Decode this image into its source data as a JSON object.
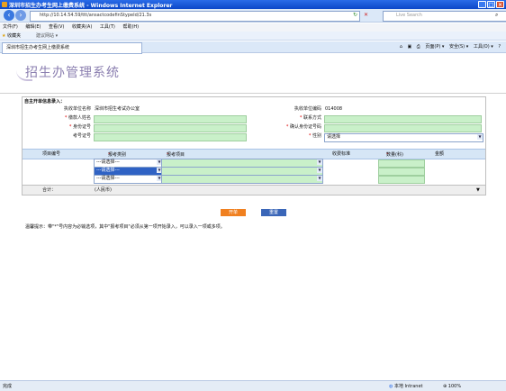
{
  "window": {
    "title": "深圳市招生办考生网上缴费系统 - Windows Internet Explorer"
  },
  "browser": {
    "address": "http://10.14.54.59/ttt/ansactcodefinStypeId/21.3s",
    "search_placeholder": "Live Search",
    "menu": [
      "文件(F)",
      "编辑(E)",
      "查看(V)",
      "收藏夹(A)",
      "工具(T)",
      "帮助(H)"
    ],
    "favorites_label": "收藏夹",
    "suggested_sites": "建议网站 ▾",
    "tab_title": "深圳市招生办考生网上缴费系统",
    "tools": [
      "页面(P) ▾",
      "安全(S) ▾",
      "工具(O) ▾"
    ]
  },
  "page": {
    "logo": "招生办管理系统",
    "form_title": "自主开单信息录入：",
    "fields": {
      "unit_name_label": "执收单位名称",
      "unit_name_value": "深圳市招生考试办公室",
      "unit_code_label": "执收单位编码",
      "unit_code_value": "014008",
      "payer_label": "缴款人姓名",
      "contact_label": "联系方式",
      "id_label": "身份证号",
      "confirm_id_label": "确认身份证号码",
      "exam_no_label": "考号证号",
      "gender_label": "性别",
      "gender_value": "请选择"
    },
    "table_headers": {
      "item_no": "项目编号",
      "category": "报考类别",
      "project": "报考项目",
      "fee": "收费标准",
      "quantity": "数量(科)",
      "amount": "金额"
    },
    "select_placeholder": "---请选择---",
    "total_label": "合计：",
    "total_value": "(人民币)",
    "submit_button": "开单",
    "reset_button": "重置",
    "notice": "温馨提示：带\"*\"号内容为必输选项，其中\"报考项目\"必须从第一项开始录入，可以录入一项或多项。"
  },
  "status": {
    "left": "完成",
    "zone": "本地 Intranet",
    "zoom": "100%"
  },
  "colors": {
    "field_bg": "#c9f0c9",
    "header_bg": "#d6e6f6",
    "submit_bg": "#f08020",
    "reset_bg": "#3a66b8",
    "logo": "#8b7fb0"
  }
}
